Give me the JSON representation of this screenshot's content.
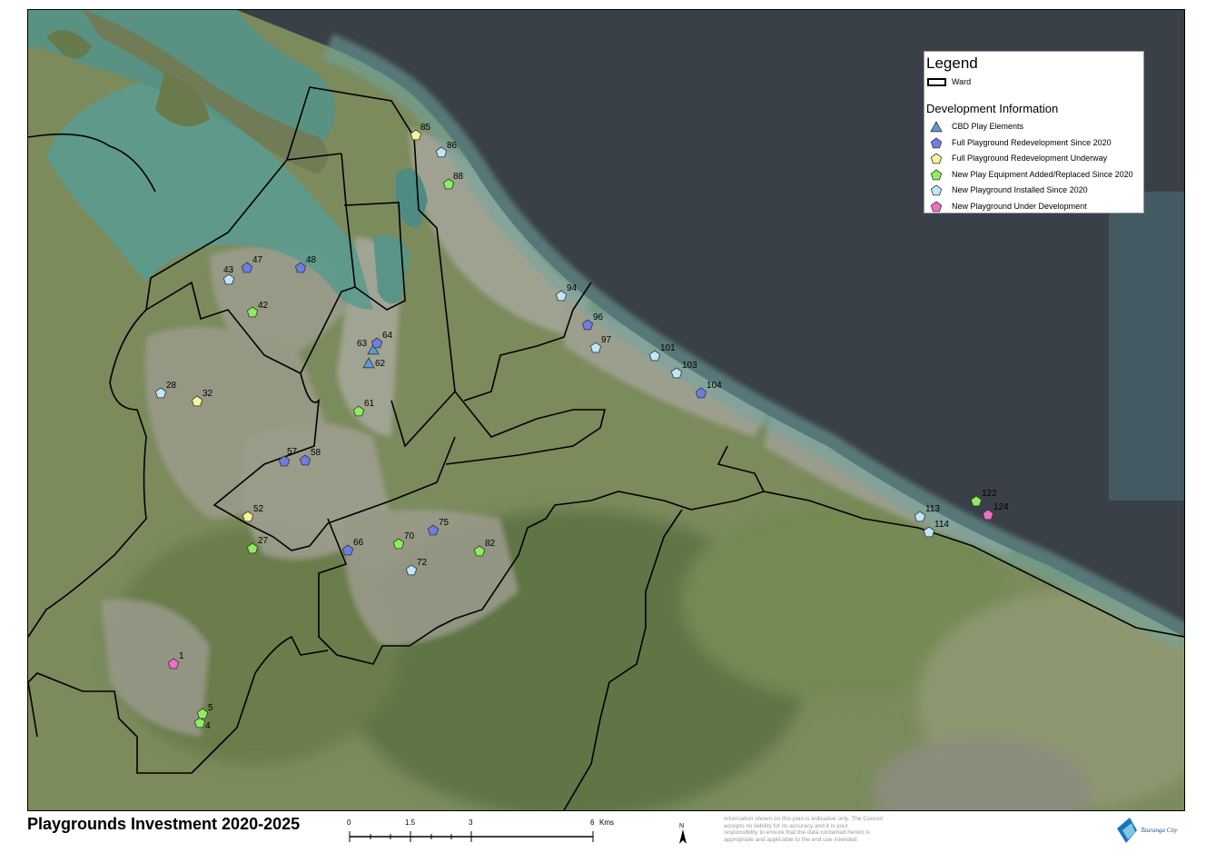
{
  "map": {
    "title": "Playgrounds Investment 2020-2025",
    "legend": {
      "title": "Legend",
      "ward_label": "Ward",
      "section_title": "Development Information",
      "categories": [
        {
          "key": "cbd",
          "label": "CBD Play Elements",
          "shape": "triangle",
          "color": "#5b9bd5"
        },
        {
          "key": "full_redev",
          "label": "Full Playground Redevelopment Since 2020",
          "shape": "pentagon",
          "color": "#6f7de0"
        },
        {
          "key": "full_underway",
          "label": "Full Playground Redevelopment Underway",
          "shape": "pentagon",
          "color": "#f7f59a"
        },
        {
          "key": "new_equipment",
          "label": "New Play Equipment Added/Replaced Since 2020",
          "shape": "pentagon",
          "color": "#8cee5c"
        },
        {
          "key": "new_installed",
          "label": "New Playground Installed Since 2020",
          "shape": "pentagon",
          "color": "#bfe6f7"
        },
        {
          "key": "new_underdev",
          "label": "New Playground Under Development",
          "shape": "pentagon",
          "color": "#ef6ec8"
        }
      ]
    },
    "playgrounds": [
      {
        "id": "1",
        "category": "new_underdev"
      },
      {
        "id": "4",
        "category": "new_equipment"
      },
      {
        "id": "5",
        "category": "new_equipment"
      },
      {
        "id": "27",
        "category": "new_equipment"
      },
      {
        "id": "28",
        "category": "new_installed"
      },
      {
        "id": "32",
        "category": "full_underway"
      },
      {
        "id": "42",
        "category": "new_equipment"
      },
      {
        "id": "43",
        "category": "new_installed"
      },
      {
        "id": "47",
        "category": "full_redev"
      },
      {
        "id": "48",
        "category": "full_redev"
      },
      {
        "id": "52",
        "category": "full_underway"
      },
      {
        "id": "57",
        "category": "full_redev"
      },
      {
        "id": "58",
        "category": "full_redev"
      },
      {
        "id": "61",
        "category": "new_equipment"
      },
      {
        "id": "62",
        "category": "cbd"
      },
      {
        "id": "63",
        "category": "cbd"
      },
      {
        "id": "64",
        "category": "full_redev"
      },
      {
        "id": "66",
        "category": "full_redev"
      },
      {
        "id": "70",
        "category": "new_equipment"
      },
      {
        "id": "72",
        "category": "new_installed"
      },
      {
        "id": "75",
        "category": "full_redev"
      },
      {
        "id": "82",
        "category": "new_equipment"
      },
      {
        "id": "85",
        "category": "full_underway"
      },
      {
        "id": "86",
        "category": "new_installed"
      },
      {
        "id": "88",
        "category": "new_equipment"
      },
      {
        "id": "94",
        "category": "new_installed"
      },
      {
        "id": "96",
        "category": "full_redev"
      },
      {
        "id": "97",
        "category": "new_installed"
      },
      {
        "id": "101",
        "category": "new_installed"
      },
      {
        "id": "103",
        "category": "new_installed"
      },
      {
        "id": "104",
        "category": "full_redev"
      },
      {
        "id": "113",
        "category": "new_installed"
      },
      {
        "id": "114",
        "category": "new_installed"
      },
      {
        "id": "122",
        "category": "new_equipment"
      },
      {
        "id": "124",
        "category": "new_underdev"
      }
    ],
    "scale": {
      "ticks": [
        "0",
        "1.5",
        "3",
        "6"
      ],
      "unit": "Kms"
    },
    "north_label": "N",
    "disclaimer": "Information shown on this plan is indicative only. The Council accepts no liability for its accuracy and it is your responsibility to ensure that the data contained herein is appropriate and applicable to the end use intended.",
    "logo_text": "Tauranga City",
    "colors": {
      "sea": "#3a3f45",
      "shallow": "#4f8f8a",
      "land": "#7d8d5e",
      "urban": "#9a9a8e",
      "ward_line": "#000000"
    }
  }
}
